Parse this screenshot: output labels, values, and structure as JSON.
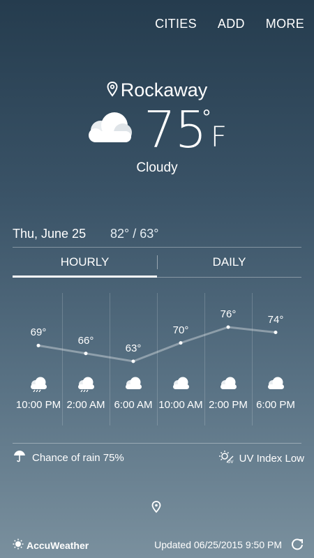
{
  "nav": {
    "cities": "CITIES",
    "add": "ADD",
    "more": "MORE"
  },
  "location": "Rockaway",
  "current": {
    "temp": "75",
    "degree": "°",
    "unit": "F",
    "condition": "Cloudy",
    "icon": "cloud-icon"
  },
  "today": {
    "date": "Thu, June 25",
    "hilo": "82° / 63°"
  },
  "tabs": {
    "hourly": "HOURLY",
    "daily": "DAILY",
    "selected": "HOURLY"
  },
  "hourly": [
    {
      "time": "10:00 PM",
      "temp": "69°",
      "icon": "cloud-rain-icon"
    },
    {
      "time": "2:00 AM",
      "temp": "66°",
      "icon": "cloud-rain-icon"
    },
    {
      "time": "6:00 AM",
      "temp": "63°",
      "icon": "cloud-icon"
    },
    {
      "time": "10:00 AM",
      "temp": "70°",
      "icon": "cloud-icon"
    },
    {
      "time": "2:00 PM",
      "temp": "76°",
      "icon": "cloud-icon"
    },
    {
      "time": "6:00 PM",
      "temp": "74°",
      "icon": "cloud-icon"
    }
  ],
  "info": {
    "rain": "Chance of rain 75%",
    "uv": "UV Index Low"
  },
  "footer": {
    "brand": "AccuWeather",
    "updated": "Updated  06/25/2015  9:50 PM"
  }
}
